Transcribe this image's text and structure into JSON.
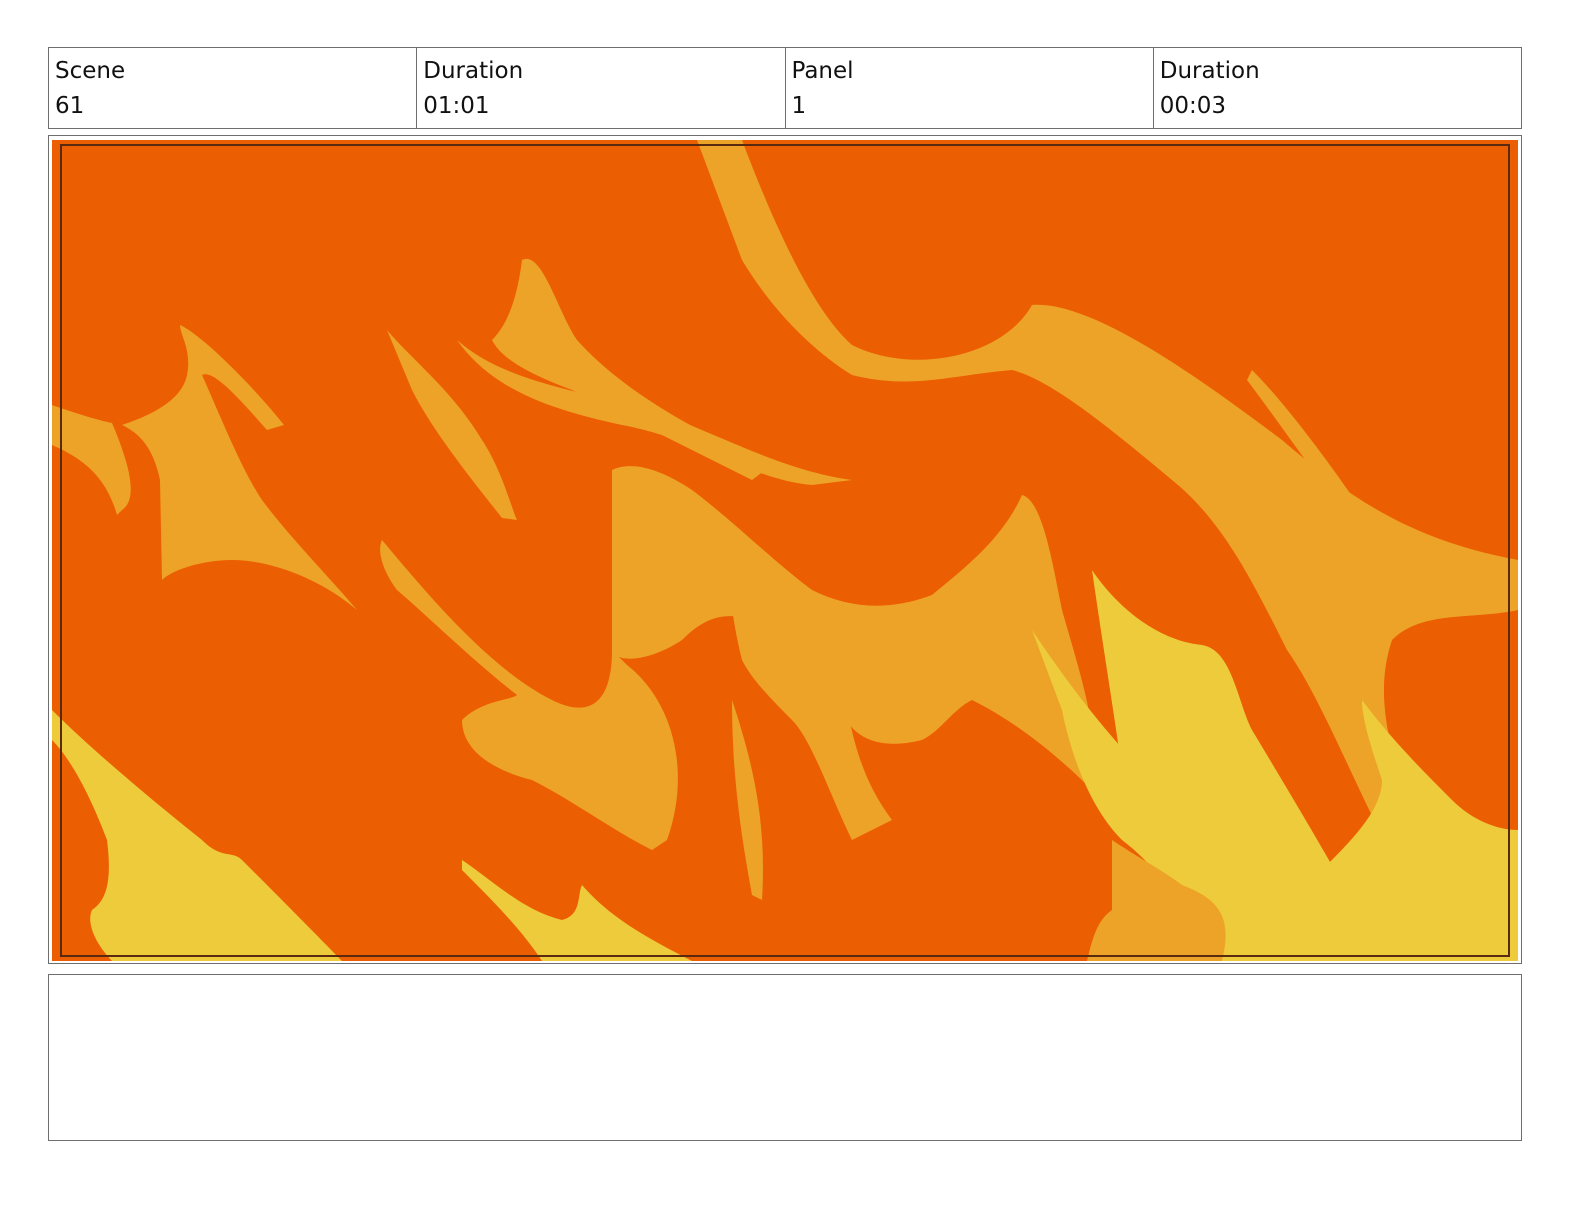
{
  "header": {
    "scene_label": "Scene",
    "scene_value": "61",
    "scene_duration_label": "Duration",
    "scene_duration_value": "01:01",
    "panel_label": "Panel",
    "panel_value": "1",
    "panel_duration_label": "Duration",
    "panel_duration_value": "00:03"
  },
  "panel": {
    "colors": {
      "background": "#EC5E02",
      "mid_flame": "#EDA327",
      "light_flame": "#EECB3B",
      "safe_frame": "#5a2a10"
    }
  },
  "notes": {
    "text": ""
  }
}
